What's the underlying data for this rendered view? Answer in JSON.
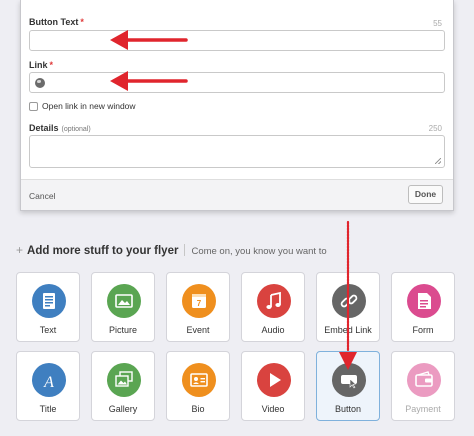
{
  "form": {
    "button_text_label": "Button Text",
    "button_text_counter": "55",
    "button_text_value": "",
    "link_label": "Link",
    "link_value": "",
    "required_mark": "*",
    "open_new_window_label": "Open link in new window",
    "details_label": "Details",
    "details_optional": "(optional)",
    "details_counter": "250",
    "cancel_label": "Cancel",
    "done_label": "Done"
  },
  "section": {
    "plus": "+",
    "title": "Add more stuff to your flyer",
    "subtitle": "Come on, you know you want to"
  },
  "tiles": [
    {
      "label": "Text",
      "icon": "text-doc-icon",
      "color": "#3f7fc0"
    },
    {
      "label": "Picture",
      "icon": "picture-icon",
      "color": "#5aa552"
    },
    {
      "label": "Event",
      "icon": "calendar-icon",
      "color": "#ef8f1e"
    },
    {
      "label": "Audio",
      "icon": "music-note-icon",
      "color": "#d9433f"
    },
    {
      "label": "Embed Link",
      "icon": "link-icon",
      "color": "#666666"
    },
    {
      "label": "Form",
      "icon": "form-icon",
      "color": "#db4b8f"
    },
    {
      "label": "Title",
      "icon": "title-a-icon",
      "color": "#3f7fc0"
    },
    {
      "label": "Gallery",
      "icon": "gallery-icon",
      "color": "#5aa552"
    },
    {
      "label": "Bio",
      "icon": "bio-card-icon",
      "color": "#ef8f1e"
    },
    {
      "label": "Video",
      "icon": "play-icon",
      "color": "#d9433f"
    },
    {
      "label": "Button",
      "icon": "button-click-icon",
      "color": "#666666"
    },
    {
      "label": "Payment",
      "icon": "wallet-icon",
      "color": "#db4b8f"
    }
  ],
  "annotation_color": "#e0252d"
}
